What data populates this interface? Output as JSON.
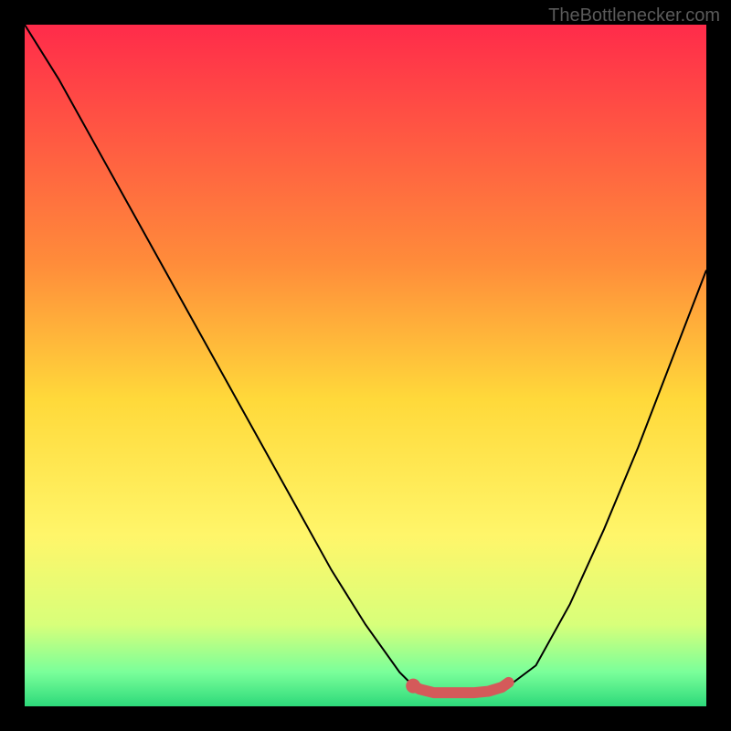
{
  "watermark": "TheBottlenecker.com",
  "chart_data": {
    "type": "line",
    "title": "",
    "xlabel": "",
    "ylabel": "",
    "xlim": [
      0,
      100
    ],
    "ylim": [
      0,
      100
    ],
    "gradient_stops": [
      {
        "offset": 0,
        "color": "#ff2b4a"
      },
      {
        "offset": 35,
        "color": "#ff8c3a"
      },
      {
        "offset": 55,
        "color": "#ffd93a"
      },
      {
        "offset": 75,
        "color": "#fff66a"
      },
      {
        "offset": 88,
        "color": "#d8ff7a"
      },
      {
        "offset": 95,
        "color": "#7aff9a"
      },
      {
        "offset": 100,
        "color": "#2dd97a"
      }
    ],
    "series": [
      {
        "name": "bottleneck-curve",
        "color": "#000000",
        "x": [
          0,
          5,
          10,
          15,
          20,
          25,
          30,
          35,
          40,
          45,
          50,
          55,
          57,
          60,
          63,
          67,
          71,
          75,
          80,
          85,
          90,
          95,
          100
        ],
        "y": [
          100,
          92,
          83,
          74,
          65,
          56,
          47,
          38,
          29,
          20,
          12,
          5,
          3,
          2,
          2,
          2,
          3,
          6,
          15,
          26,
          38,
          51,
          64
        ]
      },
      {
        "name": "optimal-zone",
        "color": "#d45a5a",
        "marker": true,
        "x": [
          57,
          58,
          60,
          62,
          64,
          66,
          68,
          70,
          71
        ],
        "y": [
          3,
          2.5,
          2,
          2,
          2,
          2,
          2.2,
          2.8,
          3.5
        ]
      }
    ]
  }
}
